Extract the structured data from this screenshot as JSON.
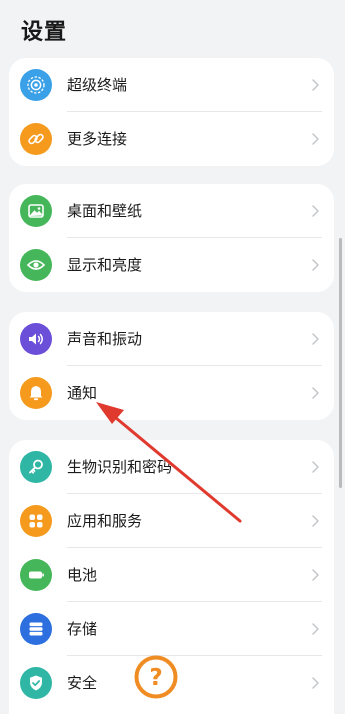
{
  "page": {
    "title": "设置"
  },
  "groups": [
    {
      "items": [
        {
          "label": "超级终端",
          "icon": "super-device-icon",
          "color": "#3aa0e8"
        },
        {
          "label": "更多连接",
          "icon": "link-icon",
          "color": "#f59a1d"
        }
      ]
    },
    {
      "items": [
        {
          "label": "桌面和壁纸",
          "icon": "wallpaper-icon",
          "color": "#45b65a"
        },
        {
          "label": "显示和亮度",
          "icon": "eye-icon",
          "color": "#45b65a"
        }
      ]
    },
    {
      "items": [
        {
          "label": "声音和振动",
          "icon": "sound-icon",
          "color": "#6c4fd8"
        },
        {
          "label": "通知",
          "icon": "bell-icon",
          "color": "#f59a1d"
        }
      ]
    },
    {
      "items": [
        {
          "label": "生物识别和密码",
          "icon": "key-icon",
          "color": "#2fb6a4"
        },
        {
          "label": "应用和服务",
          "icon": "apps-grid-icon",
          "color": "#f59a1d"
        },
        {
          "label": "电池",
          "icon": "battery-icon",
          "color": "#45b65a"
        },
        {
          "label": "存储",
          "icon": "storage-icon",
          "color": "#2e6fe0"
        },
        {
          "label": "安全",
          "icon": "shield-check-icon",
          "color": "#2fb6a4"
        }
      ]
    }
  ],
  "annotation": {
    "arrow_color": "#e03a2f",
    "help_badge_symbol": "?",
    "help_badge_color": "#f08c24"
  }
}
